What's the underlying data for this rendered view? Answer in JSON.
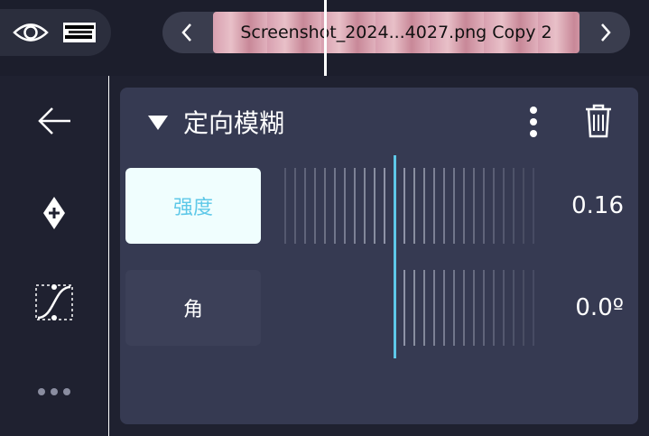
{
  "topbar": {
    "preview_icon": "eye-icon",
    "prev_icon": "chevron-left-icon",
    "next_icon": "chevron-right-icon",
    "clip_label": "Screenshot_2024...4027.png Copy 2"
  },
  "tools": {
    "back_icon": "arrow-left-icon",
    "keyframe_icon": "add-keyframe-icon",
    "curve_icon": "curve-icon",
    "more_icon": "more-horizontal-icon"
  },
  "panel": {
    "title": "定向模糊",
    "menu_icon": "more-vertical-icon",
    "delete_icon": "trash-icon",
    "params": [
      {
        "label": "强度",
        "value": "0.16",
        "selected": true
      },
      {
        "label": "角",
        "value": "0.0º",
        "selected": false
      }
    ]
  },
  "colors": {
    "accent": "#5ec8e8",
    "panel": "#363a52",
    "background": "#1f2130"
  }
}
